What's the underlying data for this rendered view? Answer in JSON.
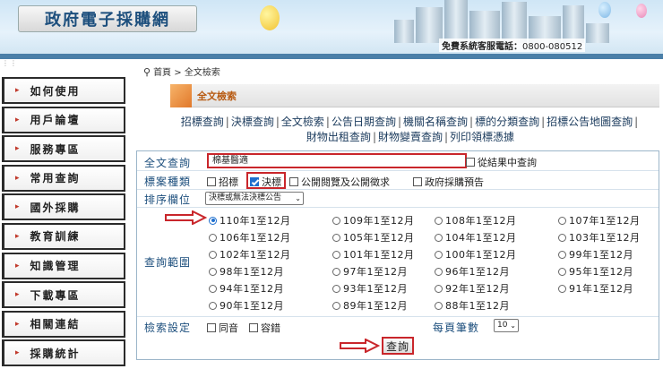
{
  "header": {
    "logo_text": "政府電子採購網",
    "hotline_label": "免費系統客服電話：",
    "hotline_number": "0800-080512"
  },
  "sidebar": {
    "items": [
      {
        "label": "如何使用"
      },
      {
        "label": "用戶論壇"
      },
      {
        "label": "服務專區"
      },
      {
        "label": "常用查詢"
      },
      {
        "label": "國外採購"
      },
      {
        "label": "教育訓練"
      },
      {
        "label": "知識管理"
      },
      {
        "label": "下載專區"
      },
      {
        "label": "相關連結"
      },
      {
        "label": "採購統計"
      }
    ]
  },
  "breadcrumb": {
    "home": "首頁",
    "sep": ">",
    "current": "全文檢索"
  },
  "tab": {
    "title": "全文檢索"
  },
  "links": [
    "招標查詢",
    "決標查詢",
    "全文檢索",
    "公告日期查詢",
    "機關名稱查詢",
    "標的分類查詢",
    "招標公告地圖查詢",
    "財物出租查詢",
    "財物變賣查詢",
    "列印領標憑據"
  ],
  "form": {
    "fulltext_label": "全文查詢",
    "fulltext_value": "棉基醫適",
    "search_in_results_label": "從結果中查詢",
    "case_type_label": "標案種類",
    "case_types": [
      {
        "label": "招標",
        "checked": false
      },
      {
        "label": "決標",
        "checked": true
      },
      {
        "label": "公開閱覽及公開徵求",
        "checked": false
      },
      {
        "label": "政府採購預告",
        "checked": false
      }
    ],
    "sort_label": "排序欄位",
    "sort_value": "決標或無法決標公告",
    "range_label": "查詢範圍",
    "ranges": [
      "110年1至12月",
      "109年1至12月",
      "108年1至12月",
      "107年1至12月",
      "106年1至12月",
      "105年1至12月",
      "104年1至12月",
      "103年1至12月",
      "102年1至12月",
      "101年1至12月",
      "100年1至12月",
      "99年1至12月",
      "98年1至12月",
      "97年1至12月",
      "96年1至12月",
      "95年1至12月",
      "94年1至12月",
      "93年1至12月",
      "92年1至12月",
      "91年1至12月",
      "90年1至12月",
      "89年1至12月",
      "88年1至12月"
    ],
    "selected_range": "110年1至12月",
    "search_settings_label": "檢索設定",
    "settings": [
      {
        "label": "同音",
        "checked": false
      },
      {
        "label": "容錯",
        "checked": false
      }
    ],
    "page_size_label": "每頁筆數",
    "page_size_value": "10",
    "submit_label": "查詢"
  },
  "colors": {
    "highlight_red": "#c9262b",
    "label_blue": "#1d4f7d",
    "check_blue": "#1f6fce"
  }
}
